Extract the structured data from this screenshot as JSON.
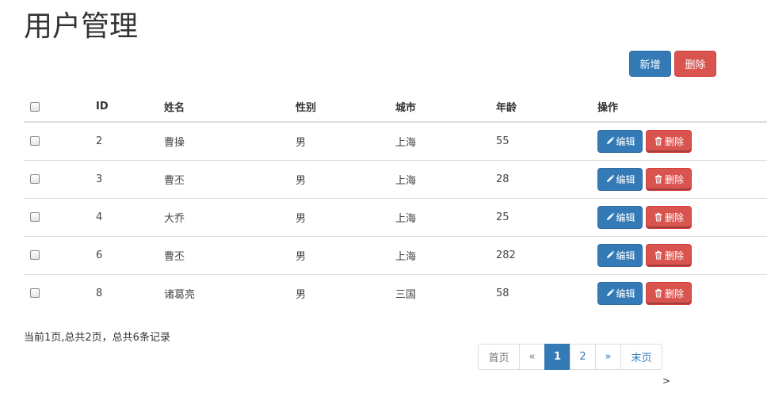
{
  "page": {
    "title": "用户管理"
  },
  "toolbar": {
    "add_label": "新增",
    "delete_label": "删除"
  },
  "table": {
    "headers": {
      "id": "ID",
      "name": "姓名",
      "gender": "性别",
      "city": "城市",
      "age": "年龄",
      "ops": "操作"
    },
    "rows": [
      {
        "id": "2",
        "name": "曹操",
        "gender": "男",
        "city": "上海",
        "age": "55"
      },
      {
        "id": "3",
        "name": "曹丕",
        "gender": "男",
        "city": "上海",
        "age": "28"
      },
      {
        "id": "4",
        "name": "大乔",
        "gender": "男",
        "city": "上海",
        "age": "25"
      },
      {
        "id": "6",
        "name": "曹丕",
        "gender": "男",
        "city": "上海",
        "age": "282"
      },
      {
        "id": "8",
        "name": "诸葛亮",
        "gender": "男",
        "city": "三国",
        "age": "58"
      }
    ],
    "row_actions": {
      "edit_label": "编辑",
      "delete_label": "删除"
    }
  },
  "footer": {
    "info": "当前1页,总共2页，总共6条记录"
  },
  "pagination": {
    "first": "首页",
    "prev": "«",
    "pages": [
      "1",
      "2"
    ],
    "next": "»",
    "last": "末页"
  },
  "stray": {
    "glyph": ">"
  },
  "colors": {
    "primary": "#337ab7",
    "danger": "#d9534f",
    "border": "#dddddd"
  },
  "icons": {
    "edit": "pencil-icon",
    "delete": "trash-icon"
  }
}
